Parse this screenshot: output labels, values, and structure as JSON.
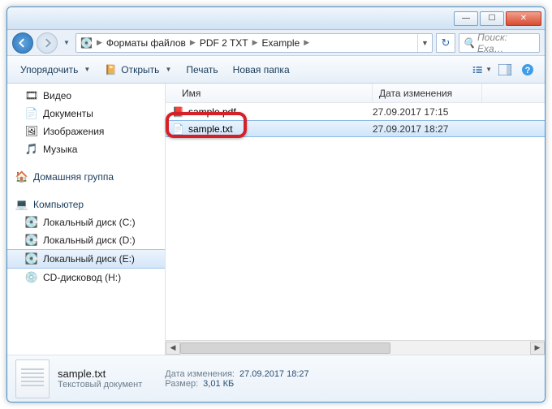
{
  "titlebar": {
    "min": "—",
    "max": "☐",
    "close": "✕"
  },
  "nav": {
    "breadcrumb": [
      {
        "icon": "💽",
        "label": ""
      },
      {
        "label": "Форматы файлов"
      },
      {
        "label": "PDF 2 TXT"
      },
      {
        "label": "Example"
      }
    ],
    "search_placeholder": "Поиск: Exa…"
  },
  "toolbar": {
    "organize": "Упорядочить",
    "open": "Открыть",
    "print": "Печать",
    "new_folder": "Новая папка"
  },
  "sidebar": {
    "items": [
      {
        "icon": "ic-video",
        "label": "Видео"
      },
      {
        "icon": "ic-doc",
        "label": "Документы"
      },
      {
        "icon": "ic-pic",
        "label": "Изображения"
      },
      {
        "icon": "ic-music",
        "label": "Музыка"
      }
    ],
    "homegroup": "Домашняя группа",
    "computer": "Компьютер",
    "drives": [
      {
        "icon": "ic-disk",
        "label": "Локальный диск (C:)"
      },
      {
        "icon": "ic-disk",
        "label": "Локальный диск (D:)"
      },
      {
        "icon": "ic-disk",
        "label": "Локальный диск (E:)",
        "selected": true
      },
      {
        "icon": "ic-cd",
        "label": "CD-дисковод (H:)"
      }
    ]
  },
  "columns": {
    "name": "Имя",
    "modified": "Дата изменения"
  },
  "files": [
    {
      "icon": "ic-pdf",
      "name": "sample.pdf",
      "date": "27.09.2017 17:15",
      "selected": false
    },
    {
      "icon": "ic-txt",
      "name": "sample.txt",
      "date": "27.09.2017 18:27",
      "selected": true,
      "highlighted": true
    }
  ],
  "details": {
    "name": "sample.txt",
    "type": "Текстовый документ",
    "modified_label": "Дата изменения:",
    "modified": "27.09.2017 18:27",
    "size_label": "Размер:",
    "size": "3,01 КБ"
  }
}
